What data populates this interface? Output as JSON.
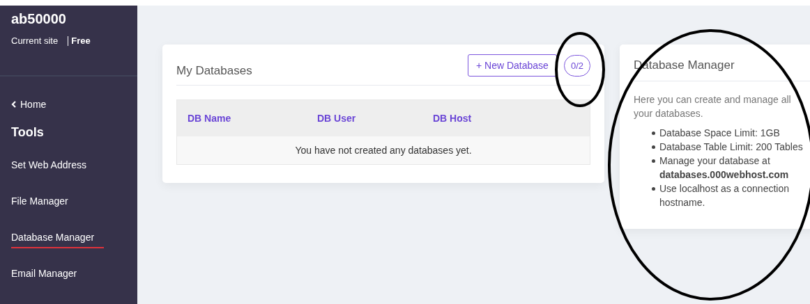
{
  "sidebar": {
    "site_name": "ab50000",
    "site_label": "Current site",
    "plan": "Free",
    "back_link": "Home",
    "section_title": "Tools",
    "items": [
      {
        "label": "Set Web Address",
        "selected": false
      },
      {
        "label": "File Manager",
        "selected": false
      },
      {
        "label": "Database Manager",
        "selected": true
      },
      {
        "label": "Email Manager",
        "selected": false
      }
    ]
  },
  "databases_card": {
    "title": "My Databases",
    "new_button": "+ New Database",
    "count_badge": "0/2",
    "table": {
      "columns": [
        "DB Name",
        "DB User",
        "DB Host"
      ],
      "empty_message": "You have not created any databases yet."
    }
  },
  "info_card": {
    "title": "Database Manager",
    "intro": "Here you can create and manage all your databases.",
    "bullets": [
      "Database Space Limit: 1GB",
      "Database Table Limit: 200 Tables",
      "Manage your database at **databases.000webhost.com**",
      "Use localhost as a connection hostname."
    ]
  }
}
